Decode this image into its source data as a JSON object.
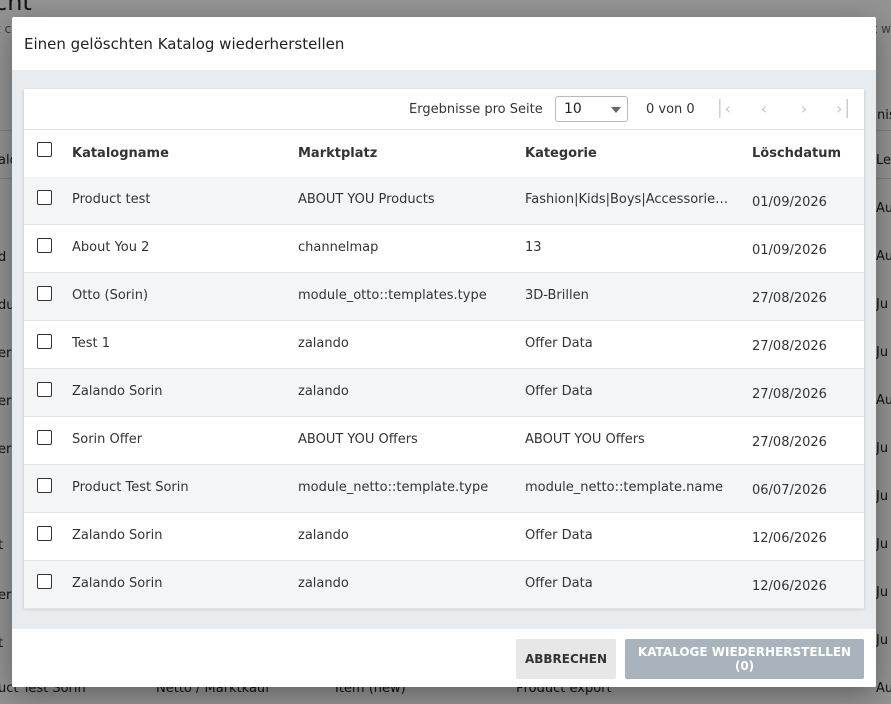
{
  "background": {
    "title_fragment": "cht",
    "sub_left": "t c",
    "sub_right": "t w",
    "col_left": "alo",
    "col_right_top": "nis",
    "col_right": "Le",
    "row_fragments_left": [
      "d",
      "du",
      "er",
      "er",
      "er",
      "t",
      "er",
      "t"
    ],
    "row_fragments_right": [
      "Au",
      "Au",
      "Ju",
      "Ju",
      "Au",
      "Ju",
      "Ju",
      "Ju",
      "Ju",
      "Ju"
    ],
    "bottom_row": [
      "uct Test Sorin",
      "Netto / Marktkauf",
      "Item (new)",
      "Product export",
      "Au"
    ]
  },
  "dialog": {
    "title": "Einen gelöschten Katalog wiederherstellen",
    "pager": {
      "label": "Ergebnisse pro Seite",
      "page_size": "10",
      "count": "0 von 0"
    },
    "columns": [
      "Katalogname",
      "Marktplatz",
      "Kategorie",
      "Löschdatum"
    ],
    "rows": [
      {
        "name": "Product test",
        "marketplace": "ABOUT YOU Products",
        "category": "Fashion|Kids|Boys|Accessories|...",
        "date": "01/09/2026"
      },
      {
        "name": "About You 2",
        "marketplace": "channelmap",
        "category": "13",
        "date": "01/09/2026"
      },
      {
        "name": "Otto (Sorin)",
        "marketplace": "module_otto::templates.type",
        "category": "3D-Brillen",
        "date": "27/08/2026"
      },
      {
        "name": "Test 1",
        "marketplace": "zalando",
        "category": "Offer Data",
        "date": "27/08/2026"
      },
      {
        "name": "Zalando Sorin",
        "marketplace": "zalando",
        "category": "Offer Data",
        "date": "27/08/2026"
      },
      {
        "name": "Sorin Offer",
        "marketplace": "ABOUT YOU Offers",
        "category": "ABOUT YOU Offers",
        "date": "27/08/2026"
      },
      {
        "name": "Product Test Sorin",
        "marketplace": "module_netto::template.type",
        "category": "module_netto::template.name",
        "date": "06/07/2026"
      },
      {
        "name": "Zalando Sorin",
        "marketplace": "zalando",
        "category": "Offer Data",
        "date": "12/06/2026"
      },
      {
        "name": "Zalando Sorin",
        "marketplace": "zalando",
        "category": "Offer Data",
        "date": "12/06/2026"
      }
    ],
    "cancel_label": "ABBRECHEN",
    "restore_label": "KATALOGE WIEDERHERSTELLEN (0)"
  }
}
